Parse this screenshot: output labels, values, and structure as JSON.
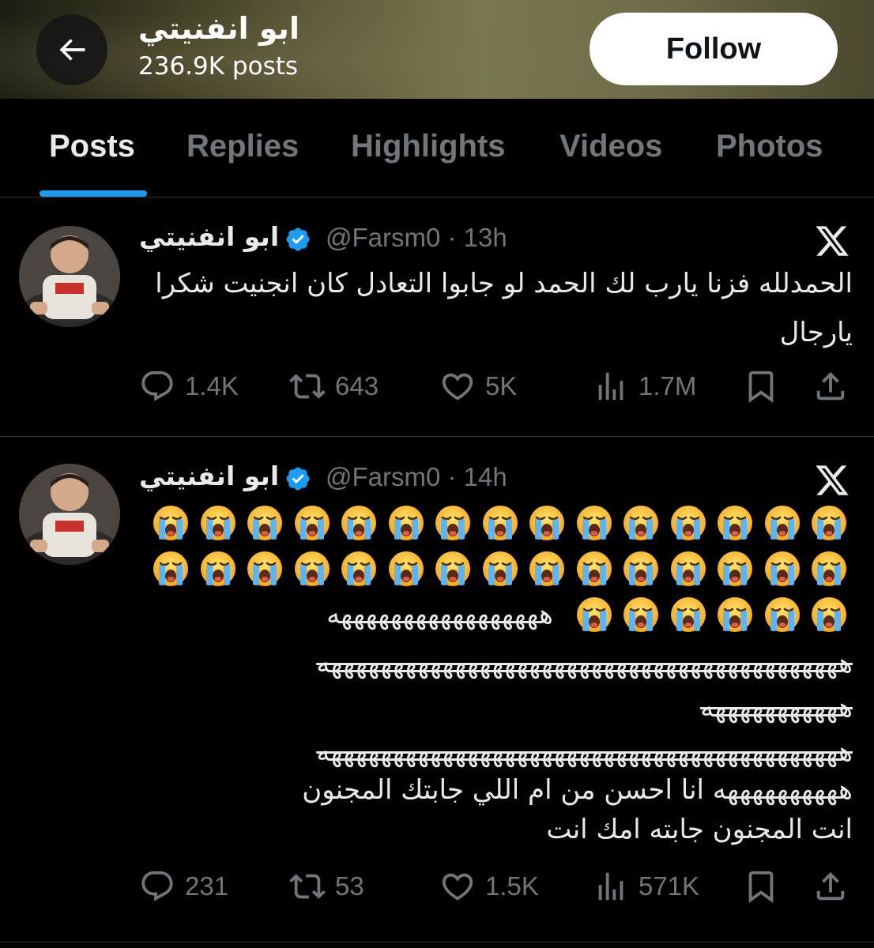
{
  "header": {
    "title": "ابو انفنيتي",
    "posts_count": "236.9K posts",
    "follow_label": "Follow"
  },
  "tabs": [
    {
      "label": "Posts",
      "active": true
    },
    {
      "label": "Replies",
      "active": false
    },
    {
      "label": "Highlights",
      "active": false
    },
    {
      "label": "Videos",
      "active": false
    },
    {
      "label": "Photos",
      "active": false
    }
  ],
  "posts": [
    {
      "author_name": "ابو انفنيتي",
      "handle": "@Farsm0",
      "time": "· 13h",
      "text": "الحمدلله فزنا يارب لك الحمد لو جابوا التعادل كان انجنيت شكرا يارجال",
      "stats": {
        "replies": "1.4K",
        "reposts": "643",
        "likes": "5K",
        "views": "1.7M"
      }
    },
    {
      "author_name": "ابو انفنيتي",
      "handle": "@Farsm0",
      "time": "· 14h",
      "emoji_count": 36,
      "emoji_icon": "loudly-crying-face-icon",
      "text_line_1": "هههههههههههههههههه",
      "text_line_2": "ههههههههههههههههههههههههههههههههههههههههههه",
      "text_line_3": "هههههههههههه",
      "text_line_4": "ههههههههههههههههههههههههههههههههههههههههههه",
      "text_line_5": "ههههههههههه انا احسن من ام اللي جابتك المجنون",
      "text_line_6": "انت المجنون جابته امك انت",
      "stats": {
        "replies": "231",
        "reposts": "53",
        "likes": "1.5K",
        "views": "571K"
      }
    }
  ],
  "colors": {
    "background": "#000000",
    "text_primary": "#e7e9ea",
    "text_secondary": "#71767b",
    "accent_blue": "#1d9bf0",
    "divider": "#2f3336"
  }
}
